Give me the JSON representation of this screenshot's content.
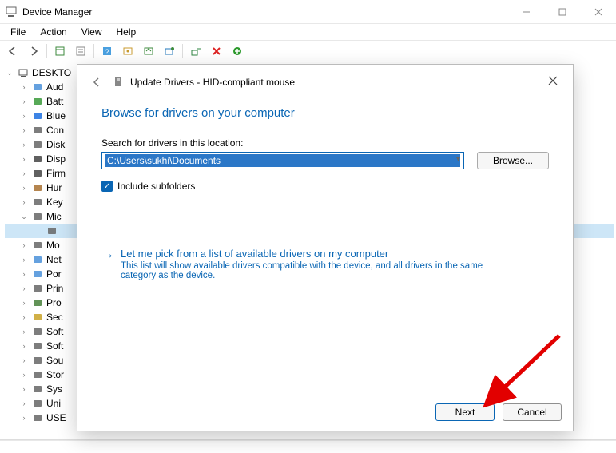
{
  "window": {
    "title": "Device Manager",
    "menus": [
      "File",
      "Action",
      "View",
      "Help"
    ]
  },
  "tree": {
    "root": "DESKTO",
    "items": [
      "Aud",
      "Batt",
      "Blue",
      "Con",
      "Disk",
      "Disp",
      "Firm",
      "Hur",
      "Key",
      "Mic",
      "",
      "Mo",
      "Net",
      "Por",
      "Prin",
      "Pro",
      "Sec",
      "Soft",
      "Soft",
      "Sou",
      "Stor",
      "Sys",
      "Uni",
      "USE"
    ],
    "expanded_index": 9,
    "highlighted_sub_index": 10
  },
  "dialog": {
    "title": "Update Drivers - HID-compliant mouse",
    "heading": "Browse for drivers on your computer",
    "path_label": "Search for drivers in this location:",
    "path_value": "C:\\Users\\sukhi\\Documents",
    "browse_label": "Browse...",
    "include_subfolders_label": "Include subfolders",
    "include_subfolders_checked": true,
    "pick_link": "Let me pick from a list of available drivers on my computer",
    "pick_desc": "This list will show available drivers compatible with the device, and all drivers in the same category as the device.",
    "next_label": "Next",
    "cancel_label": "Cancel"
  }
}
